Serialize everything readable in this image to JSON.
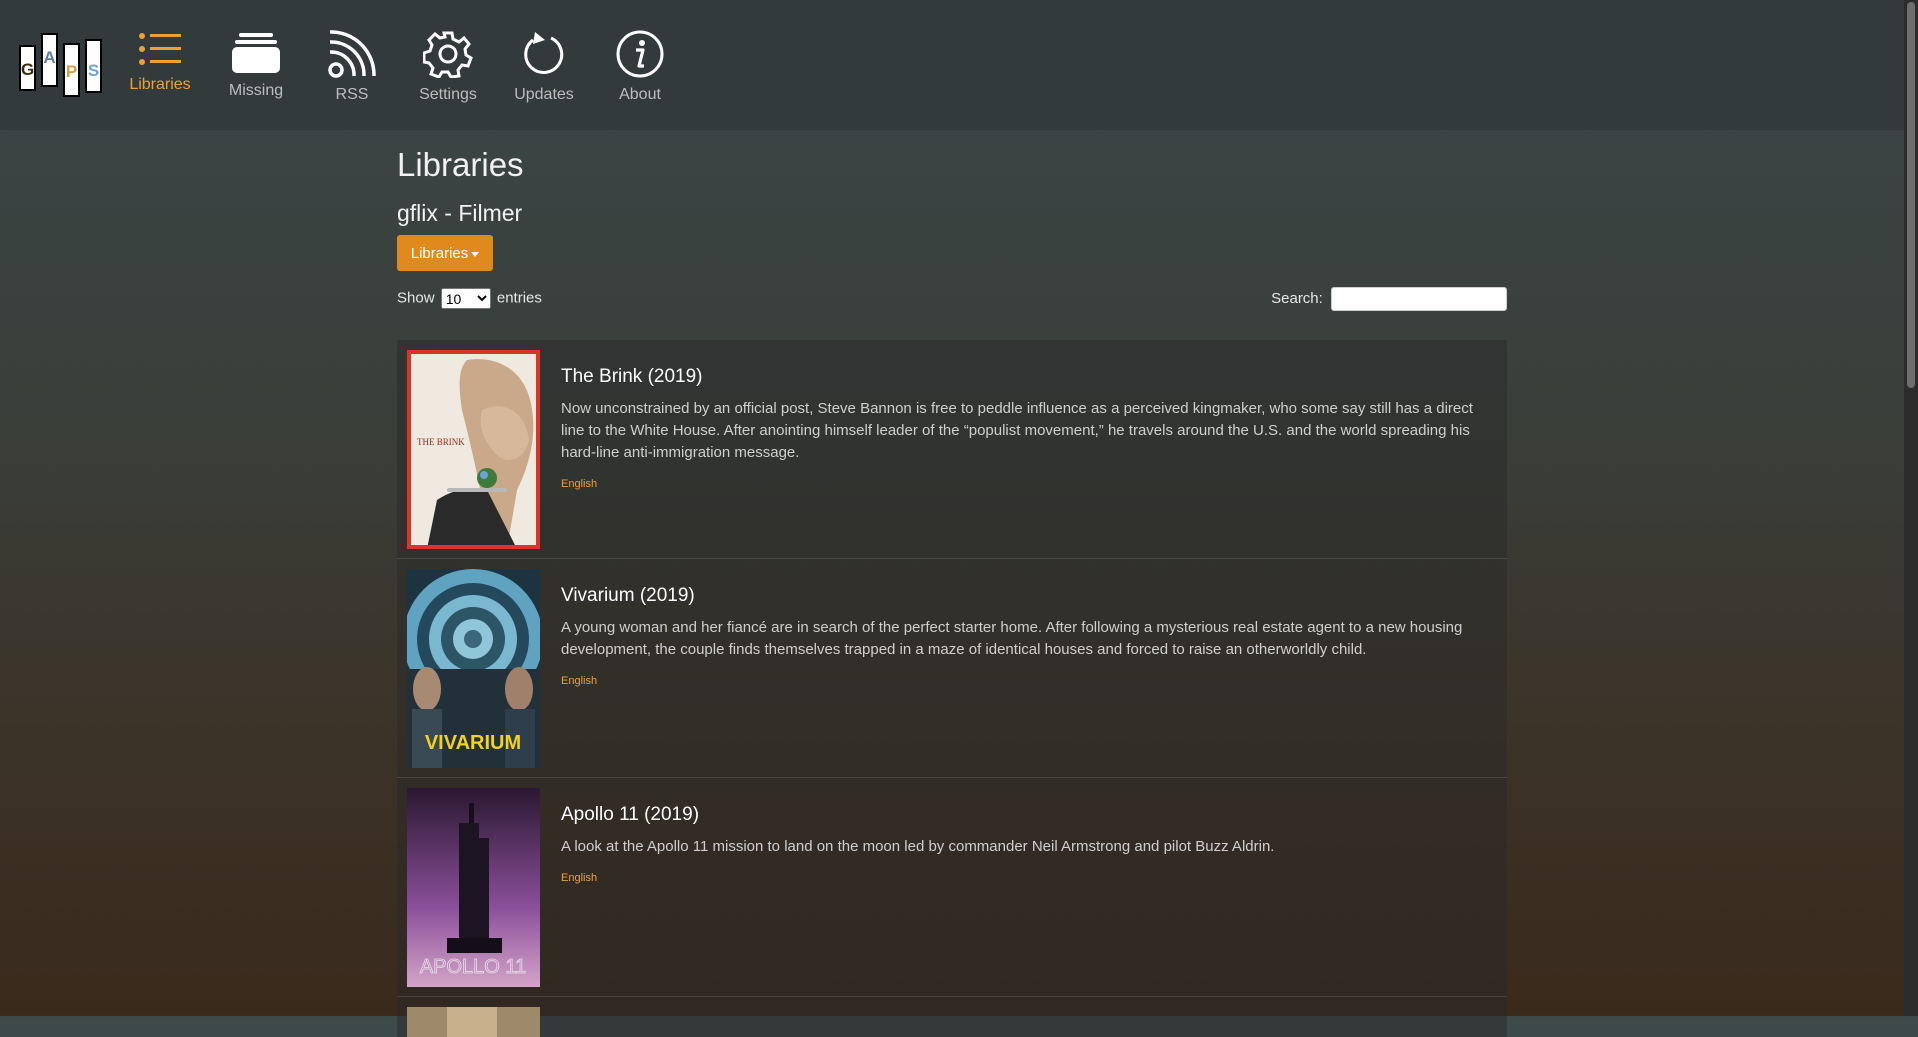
{
  "nav": {
    "logo_letters": [
      "G",
      "A",
      "P",
      "S"
    ],
    "items": [
      {
        "label": "Libraries",
        "icon": "list-icon",
        "active": true
      },
      {
        "label": "Missing",
        "icon": "stack-icon",
        "active": false
      },
      {
        "label": "RSS",
        "icon": "rss-icon",
        "active": false
      },
      {
        "label": "Settings",
        "icon": "gear-icon",
        "active": false
      },
      {
        "label": "Updates",
        "icon": "refresh-icon",
        "active": false
      },
      {
        "label": "About",
        "icon": "info-icon",
        "active": false
      }
    ]
  },
  "page": {
    "title": "Libraries",
    "library_name": "gflix - Filmer",
    "libraries_button": "Libraries",
    "show_label": "Show",
    "entries_label": "entries",
    "entries_value": "10",
    "entries_options": [
      "10"
    ],
    "search_label": "Search:",
    "search_value": ""
  },
  "movies": [
    {
      "title": "The Brink (2019)",
      "description": "Now unconstrained by an official post, Steve Bannon is free to peddle influence as a perceived kingmaker, who some say still has a direct line to the White House. After anointing himself leader of the “populist movement,” he travels around the U.S. and the world spreading his hard-line anti-immigration message.",
      "language": "English",
      "poster_text": "THE BRINK"
    },
    {
      "title": "Vivarium (2019)",
      "description": "A young woman and her fiancé are in search of the perfect starter home. After following a mysterious real estate agent to a new housing development, the couple finds themselves trapped in a maze of identical houses and forced to raise an otherworldly child.",
      "language": "English",
      "poster_text": "VIVARIUM"
    },
    {
      "title": "Apollo 11 (2019)",
      "description": "A look at the Apollo 11 mission to land on the moon led by commander Neil Armstrong and pilot Buzz Aldrin.",
      "language": "English",
      "poster_text": "APOLLO 11"
    }
  ],
  "colors": {
    "accent": "#f0a030",
    "button": "#e08a1e",
    "selected_outline": "#d7362b"
  }
}
